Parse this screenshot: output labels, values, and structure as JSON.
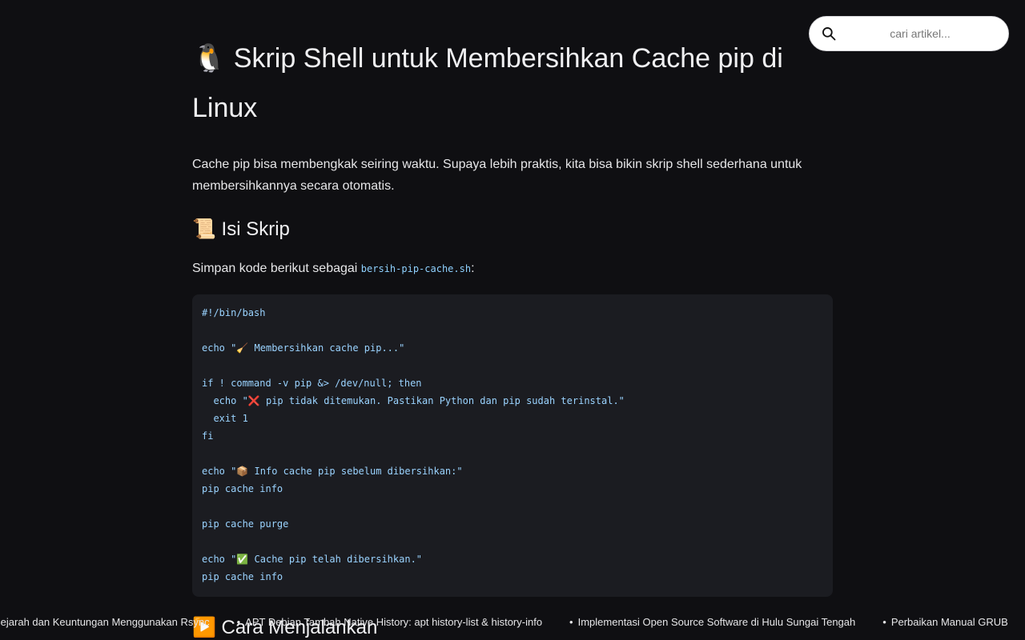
{
  "article": {
    "title": "🐧 Skrip Shell untuk Membersihkan Cache pip di Linux",
    "intro": "Cache pip bisa membengkak seiring waktu. Supaya lebih praktis, kita bisa bikin skrip shell sederhana untuk membersihkannya secara otomatis.",
    "section_script_heading": "📜 Isi Skrip",
    "save_text_before": "Simpan kode berikut sebagai ",
    "save_filename": "bersih-pip-cache.sh",
    "save_text_after": ":",
    "code_lines": [
      "#!/bin/bash",
      "",
      "echo \"🧹 Membersihkan cache pip...\"",
      "",
      "if ! command -v pip &> /dev/null; then",
      "  echo \"❌ pip tidak ditemukan. Pastikan Python dan pip sudah terinstal.\"",
      "  exit 1",
      "fi",
      "",
      "echo \"📦 Info cache pip sebelum dibersihkan:\"",
      "pip cache info",
      "",
      "pip cache purge",
      "",
      "echo \"✅ Cache pip telah dibersihkan.\"",
      "pip cache info"
    ],
    "section_run_heading": "▶️ Cara Menjalankan"
  },
  "search": {
    "placeholder": "cari artikel...",
    "icon": "search-icon"
  },
  "ticker": {
    "bullet": "•",
    "items": [
      "Sejarah dan Keuntungan Menggunakan Rsync",
      "APT Debian Tambah Native History: apt history-list & history-info",
      "Implementasi Open Source Software di Hulu Sungai Tengah",
      "Perbaikan Manual GRUB"
    ]
  },
  "colors": {
    "background": "#0f0f12",
    "code_background": "#1b1c21",
    "code_text": "#9ad3ff"
  }
}
